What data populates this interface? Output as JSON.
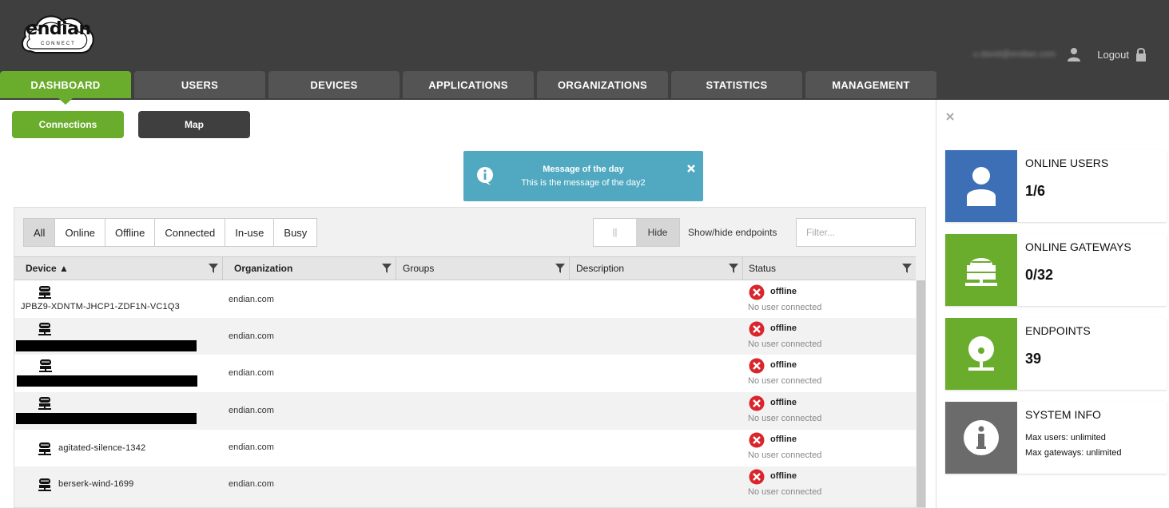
{
  "header": {
    "logo_text": "endian",
    "logo_subtext": "CONNECT",
    "user_email": "u.david@endian.com",
    "logout_label": "Logout"
  },
  "nav": {
    "tabs": [
      {
        "label": "DASHBOARD",
        "active": true
      },
      {
        "label": "USERS"
      },
      {
        "label": "DEVICES"
      },
      {
        "label": "APPLICATIONS"
      },
      {
        "label": "ORGANIZATIONS"
      },
      {
        "label": "STATISTICS"
      },
      {
        "label": "MANAGEMENT"
      }
    ]
  },
  "subtabs": {
    "connections": "Connections",
    "map": "Map"
  },
  "motd": {
    "title": "Message of the day",
    "text": "This is the message of the day2"
  },
  "filters": {
    "buttons": [
      "All",
      "Online",
      "Offline",
      "Connected",
      "In-use",
      "Busy"
    ],
    "active": "All",
    "toggle_knob": "||",
    "toggle_hide": "Hide",
    "toggle_label": "Show/hide endpoints",
    "filter_placeholder": "Filter..."
  },
  "table": {
    "headers": {
      "device": "Device ▲",
      "organization": "Organization",
      "groups": "Groups",
      "description": "Description",
      "status": "Status"
    },
    "rows": [
      {
        "device": "JPBZ9-XDNTM-JHCP1-ZDF1N-VC1Q3",
        "organization": "endian.com",
        "status": "offline",
        "substatus": "No user connected"
      },
      {
        "device": "",
        "organization": "endian.com",
        "status": "offline",
        "substatus": "No user connected"
      },
      {
        "device": "",
        "organization": "endian.com",
        "status": "offline",
        "substatus": "No user connected"
      },
      {
        "device": "",
        "organization": "endian.com",
        "status": "offline",
        "substatus": "No user connected"
      },
      {
        "device": "agitated-silence-1342",
        "organization": "endian.com",
        "status": "offline",
        "substatus": "No user connected"
      },
      {
        "device": "berserk-wind-1699",
        "organization": "endian.com",
        "status": "offline",
        "substatus": "No user connected"
      }
    ]
  },
  "sidebar": {
    "online_users": {
      "title": "ONLINE USERS",
      "value": "1/6",
      "color": "#3d6fb6"
    },
    "online_gateways": {
      "title": "ONLINE GATEWAYS",
      "value": "0/32",
      "color": "#6aad2d"
    },
    "endpoints": {
      "title": "ENDPOINTS",
      "value": "39",
      "color": "#6aad2d"
    },
    "system_info": {
      "title": "SYSTEM INFO",
      "max_users": "Max users: unlimited",
      "max_gateways": "Max gateways: unlimited",
      "color": "#6b6b6b"
    }
  },
  "colors": {
    "accent": "#6aad2d",
    "header_bg": "#3f3f3f",
    "motd_bg": "#51a9c1",
    "status_error": "#d9262c"
  }
}
